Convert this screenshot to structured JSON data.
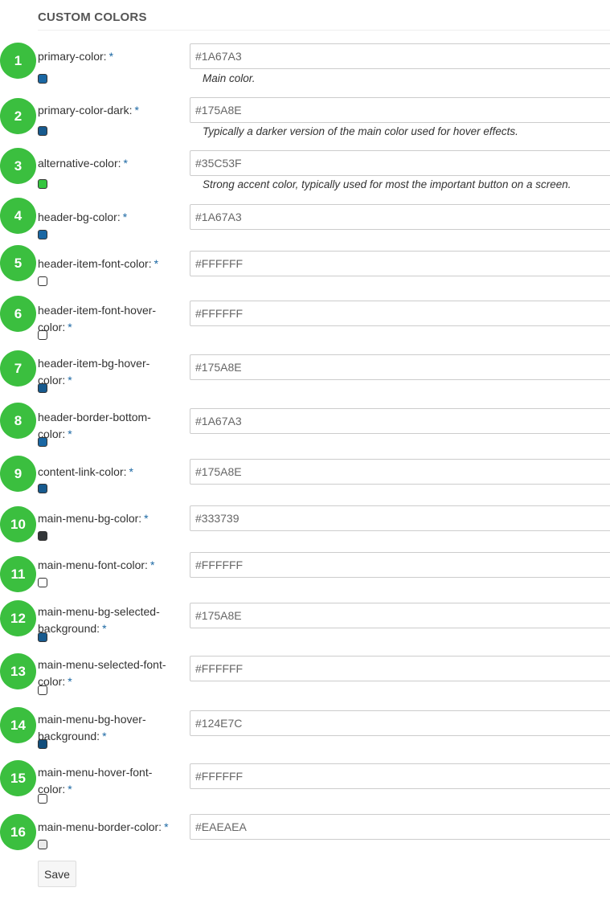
{
  "section": {
    "title": "CUSTOM COLORS"
  },
  "fields": [
    {
      "badge": "1",
      "label": "primary-color:",
      "required": "*",
      "value": "#1A67A3",
      "swatch": "#1A67A3",
      "help": "Main color."
    },
    {
      "badge": "2",
      "label": "primary-color-dark:",
      "required": "*",
      "value": "#175A8E",
      "swatch": "#175A8E",
      "help": "Typically a darker version of the main color used for hover effects."
    },
    {
      "badge": "3",
      "label": "alternative-color:",
      "required": "*",
      "value": "#35C53F",
      "swatch": "#35C53F",
      "help": "Strong accent color, typically used for most the important button on a screen."
    },
    {
      "badge": "4",
      "label": "header-bg-color:",
      "required": "*",
      "value": "#1A67A3",
      "swatch": "#1A67A3"
    },
    {
      "badge": "5",
      "label": "header-item-font-color:",
      "required": "*",
      "value": "#FFFFFF",
      "swatch": "#FFFFFF"
    },
    {
      "badge": "6",
      "label": "header-item-font-hover-color:",
      "required": "*",
      "value": "#FFFFFF",
      "swatch": "#FFFFFF"
    },
    {
      "badge": "7",
      "label": "header-item-bg-hover-color:",
      "required": "*",
      "value": "#175A8E",
      "swatch": "#175A8E"
    },
    {
      "badge": "8",
      "label": "header-border-bottom-color:",
      "required": "*",
      "value": "#1A67A3",
      "swatch": "#1A67A3"
    },
    {
      "badge": "9",
      "label": "content-link-color:",
      "required": "*",
      "value": "#175A8E",
      "swatch": "#175A8E"
    },
    {
      "badge": "10",
      "label": "main-menu-bg-color:",
      "required": "*",
      "value": "#333739",
      "swatch": "#333739"
    },
    {
      "badge": "11",
      "label": "main-menu-font-color:",
      "required": "*",
      "value": "#FFFFFF",
      "swatch": "#FFFFFF"
    },
    {
      "badge": "12",
      "label": "main-menu-bg-selected-background:",
      "required": "*",
      "value": "#175A8E",
      "swatch": "#175A8E"
    },
    {
      "badge": "13",
      "label": "main-menu-selected-font-color:",
      "required": "*",
      "value": "#FFFFFF",
      "swatch": "#FFFFFF"
    },
    {
      "badge": "14",
      "label": "main-menu-bg-hover-background:",
      "required": "*",
      "value": "#124E7C",
      "swatch": "#124E7C"
    },
    {
      "badge": "15",
      "label": "main-menu-hover-font-color:",
      "required": "*",
      "value": "#FFFFFF",
      "swatch": "#FFFFFF"
    },
    {
      "badge": "16",
      "label": "main-menu-border-color:",
      "required": "*",
      "value": "#EAEAEA",
      "swatch": "#EAEAEA"
    }
  ],
  "actions": {
    "save_label": "Save"
  }
}
